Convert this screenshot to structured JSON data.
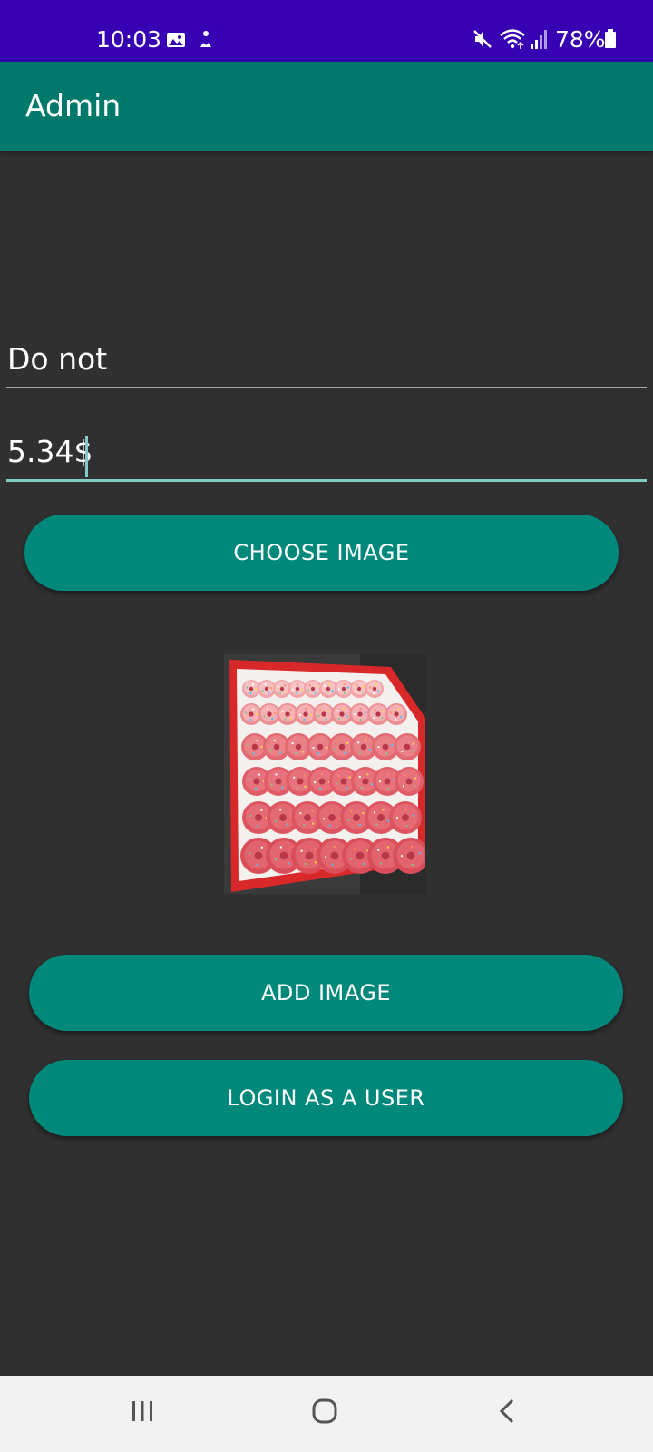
{
  "status_bar": {
    "time": "10:03",
    "battery": "78%",
    "icons": [
      "gallery-icon",
      "app-notification-icon",
      "mute-icon",
      "wifi-icon",
      "signal-icon",
      "battery-icon"
    ],
    "background": "#3700b3"
  },
  "app_bar": {
    "title": "Admin",
    "background": "#00796b"
  },
  "form": {
    "name_value": "Do not",
    "price_value": "5.34$",
    "choose_image_label": "CHOOSE IMAGE",
    "add_image_label": "ADD IMAGE",
    "login_as_user_label": "LOGIN AS A USER",
    "button_color": "#00897b",
    "focus_color": "#80cbc4"
  },
  "preview": {
    "subject": "tray of pink frosted donuts with sprinkles"
  },
  "nav_bar": {
    "icons": [
      "recents-icon",
      "home-icon",
      "back-icon"
    ]
  }
}
